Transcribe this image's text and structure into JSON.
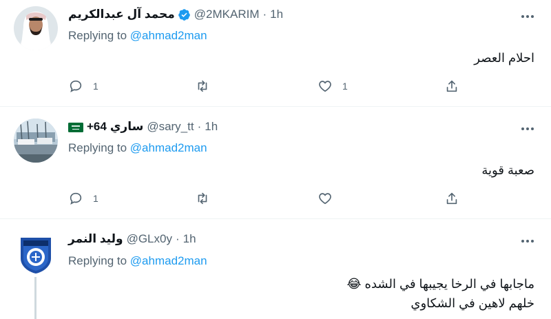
{
  "tweets": [
    {
      "name": "محمد آل عبدالكريم",
      "handle": "@2MKARIM",
      "time": "1h",
      "replying_prefix": "Replying to",
      "replying_to": "@ahmad2man",
      "text": "احلام العصر",
      "reply_count": "1",
      "retweet_count": "",
      "like_count": "1",
      "verified": true
    },
    {
      "name": "ساري",
      "name_suffix": "+64",
      "handle": "@sary_tt",
      "time": "1h",
      "replying_prefix": "Replying to",
      "replying_to": "@ahmad2man",
      "text": "صعبة قوية",
      "reply_count": "1",
      "retweet_count": "",
      "like_count": "",
      "flag": "saudi-flag-icon"
    },
    {
      "name": "وليد النمر",
      "handle": "@GLx0y",
      "time": "1h",
      "replying_prefix": "Replying to",
      "replying_to": "@ahmad2man",
      "text_line1": "ماجابها في الرخا يجيبها في الشده 😂",
      "text_line2": "خلهم لاهين في الشكاوي"
    }
  ],
  "colors": {
    "accent": "#1d9bf0",
    "secondary_text": "#536471",
    "divider": "#eff3f4"
  }
}
